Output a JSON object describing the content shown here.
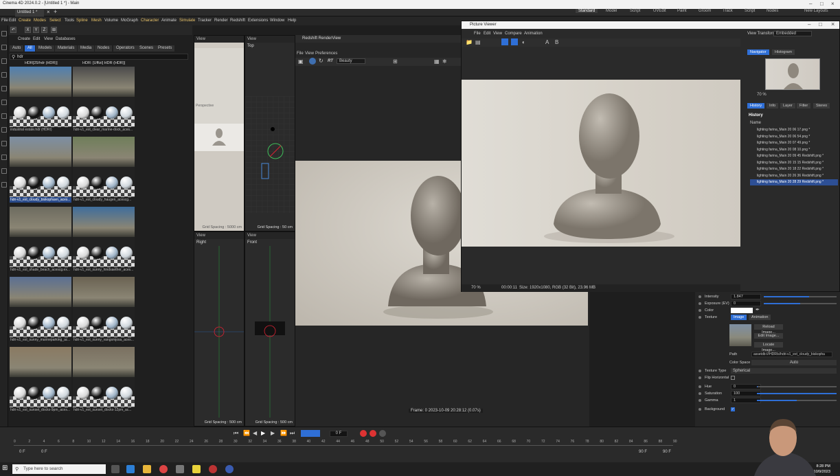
{
  "window": {
    "title": "Cinema 4D 2024.0.2 - [Untitled 1 *] - Main",
    "doc_tab": "Untitled 1 *"
  },
  "menubar": [
    "File",
    "Edit",
    "Create",
    "Modes",
    "Select",
    "Tools",
    "Spline",
    "Mesh",
    "Volume",
    "MoGraph",
    "Character",
    "Animate",
    "Simulate",
    "Tracker",
    "Render",
    "Redshift",
    "Extensions",
    "Window",
    "Help"
  ],
  "layouts": [
    "Standard",
    "Model",
    "Script",
    "UVEdit",
    "Paint",
    "Groom",
    "Track",
    "Script",
    "Nodes",
    "New Layouts"
  ],
  "asset_browser": {
    "menu": [
      "Create",
      "Edit",
      "View",
      "Databases"
    ],
    "filters": [
      "Auto",
      "All",
      "Models",
      "Materials",
      "Media",
      "Nodes",
      "Operators",
      "Scenes",
      "Presets"
    ],
    "search_value": "hdr",
    "col_heads": [
      "HDR[25/hdr (HDR)]",
      "HDR: [Uffizi] HDR (HDR)]"
    ],
    "items": [
      {
        "label": "industrial estate.hdr (HDRI)",
        "pano": "#4f7fb0",
        "selected": false
      },
      {
        "label": "hdri-v1_ext_clear_marine-dock_aces...",
        "pano": "#4a4a4a",
        "selected": false
      },
      {
        "label": "hdri-v1_ext_cloudy_biskophavn_aces...",
        "pano": "#7d8fa3",
        "selected": true
      },
      {
        "label": "hdri-v1_ext_cloudy_haugen_acescg...",
        "pano": "#6f7e5a",
        "selected": false
      },
      {
        "label": "hdri-v1_ext_shade_beach_acescg.ex...",
        "pano": "#6d6b5f",
        "selected": false
      },
      {
        "label": "hdri-v1_ext_sunny_hindsaether_aces...",
        "pano": "#3f6d9c",
        "selected": false
      },
      {
        "label": "hdri-v1_ext_sunny_marineparking_ac...",
        "pano": "#5a6f92",
        "selected": false
      },
      {
        "label": "hdri-v1_ext_sunny_vangsmjosa_aces...",
        "pano": "#6a6252",
        "selected": false
      },
      {
        "label": "hdri-v1_ext_sunset_docks-9pm_aces...",
        "pano": "#8a7a62",
        "selected": false
      },
      {
        "label": "hdri-v1_ext_sunset_docks-12pm_ac...",
        "pano": "#7a7060",
        "selected": false
      }
    ]
  },
  "viewports": {
    "view_label": "View",
    "top_label": "Top",
    "right_label": "Right",
    "front_label": "Front",
    "grid_top": "Grid Spacing : 50 cm",
    "grid_right": "Grid Spacing : 500 cm",
    "grid_front": "Grid Spacing : 500 cm",
    "persp_label": "Perspective",
    "persp_grid": "Grid Spacing : 5000 cm"
  },
  "renderview": {
    "title": "Redshift RenderView",
    "menu": [
      "File",
      "View",
      "Preferences"
    ],
    "aov": "Beauty",
    "rt": "RT",
    "frame_info": "Frame: 0 2023-10-09 20:28:12 (0.07s)"
  },
  "picture_viewer": {
    "title": "Picture Viewer",
    "menu": [
      "File",
      "Edit",
      "View",
      "Compare",
      "Animation"
    ],
    "view_transform_label": "View Transform",
    "view_transform_value": "Embedded",
    "zoom": "70 %",
    "status_time": "00:00:11",
    "status_size": "Size: 1920x1080, RGB (32 Bit), 23.96 MB",
    "tabs_top": [
      "Navigator",
      "Histogram"
    ],
    "nav_zoom": "70 %",
    "tabs_mid": [
      "History",
      "Info",
      "Layer",
      "Filter",
      "Stereo"
    ],
    "history_heading": "History",
    "name_col": "Name",
    "history": [
      "lighting farina_Main 20 06 17.png *",
      "lighting farina_Main 20 06 54.png *",
      "lighting farina_Main 20 07 49.png *",
      "lighting farina_Main 20 08 10.png *",
      "lighting farina_Main 20 09 45 Redshift.png *",
      "lighting farina_Main 20 15 15 Redshift.png *",
      "lighting farina_Main 20 18 22 Redshift.png *",
      "lighting farina_Main 20 26 36 Redshift.png *",
      "lighting farina_Main 20 28 29 Redshift.png *"
    ]
  },
  "attributes": {
    "intensity_label": "Intensity",
    "intensity": "1.847",
    "intensity_frac": 0.62,
    "exposure_label": "Exposure (EV)",
    "exposure": "0",
    "exposure_frac": 0.5,
    "color_label": "Color",
    "texture_label": "Texture",
    "tex_tabs": [
      "Image",
      "Animation"
    ],
    "buttons": [
      "Reload Image...",
      "Edit Image...",
      "Locate Image..."
    ],
    "path_label": "Path",
    "path": "assetdb:///HDRIs/hdri-v1_ext_cloudy_biskopha",
    "colorspace_label": "Color Space",
    "colorspace": "Auto",
    "texture_type_label": "Texture Type",
    "texture_type": "Spherical",
    "flip_label": "Flip Horizontal",
    "hue_label": "Hue",
    "hue": "0",
    "hue_frac": 0.0,
    "saturation_label": "Saturation",
    "saturation": "100",
    "saturation_frac": 1.0,
    "gamma_label": "Gamma",
    "gamma": "1",
    "gamma_frac": 0.5,
    "background_label": "Background"
  },
  "timeline": {
    "ticks": [
      "0",
      "2",
      "4",
      "6",
      "8",
      "10",
      "12",
      "14",
      "16",
      "18",
      "20",
      "22",
      "24",
      "26",
      "28",
      "30",
      "32",
      "34",
      "36",
      "38",
      "40",
      "42",
      "44",
      "46",
      "48",
      "50",
      "52",
      "54",
      "56",
      "58",
      "60",
      "62",
      "64",
      "66",
      "68",
      "70",
      "72",
      "74",
      "76",
      "78",
      "80",
      "82",
      "84",
      "86",
      "88",
      "90"
    ],
    "current": "0 F",
    "start": "0 F",
    "start2": "0 F",
    "end": "90 F",
    "end2": "90 F"
  },
  "taskbar": {
    "search_placeholder": "Type here to search",
    "time": "8:28 PM",
    "date": "10/9/2023"
  }
}
